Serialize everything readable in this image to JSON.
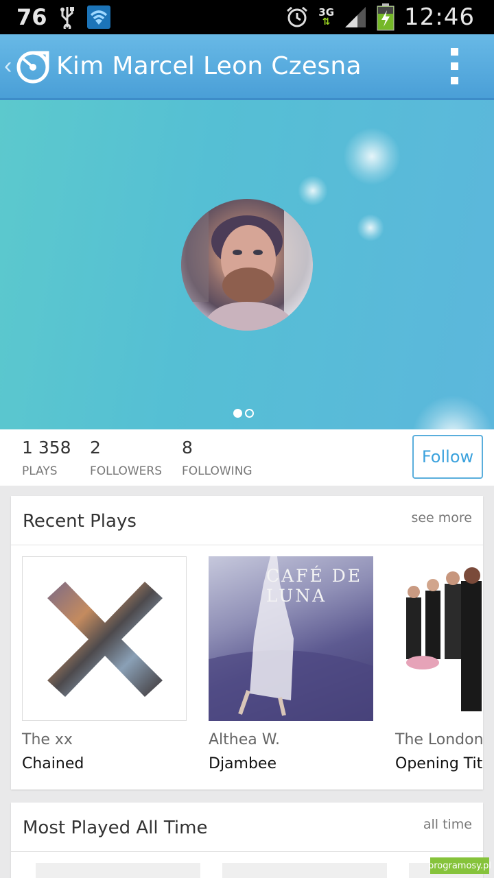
{
  "status_bar": {
    "notification_count": "76",
    "network": "3G",
    "time": "12:46",
    "icons": [
      "usb-icon",
      "wifi-icon",
      "alarm-icon",
      "signal-icon",
      "battery-charging-icon"
    ]
  },
  "action_bar": {
    "title": "Kim Marcel Leon Czesna",
    "back_glyph": "‹",
    "overflow_icon": "overflow-menu-icon"
  },
  "hero": {
    "pager": {
      "pages": 2,
      "current": 1
    }
  },
  "stats": {
    "plays_value": "1 358",
    "plays_label": "PLAYS",
    "followers_value": "2",
    "followers_label": "FOLLOWERS",
    "following_value": "8",
    "following_label": "FOLLOWING",
    "follow_label": "Follow"
  },
  "recent_plays": {
    "title": "Recent Plays",
    "action": "see more",
    "items": [
      {
        "artist": "The xx",
        "title": "Chained"
      },
      {
        "artist": "Althea W.",
        "title": "Djambee",
        "cover_text": "CAFÉ DE LUNA"
      },
      {
        "artist": "The London",
        "title": "Opening Tit"
      }
    ]
  },
  "most_played": {
    "title": "Most Played All Time",
    "action": "all time"
  },
  "watermark": "programosy.pl",
  "colors": {
    "action_bar": "#4a9fd7",
    "accent": "#3ba2dd",
    "hero": "#55bfd4"
  }
}
